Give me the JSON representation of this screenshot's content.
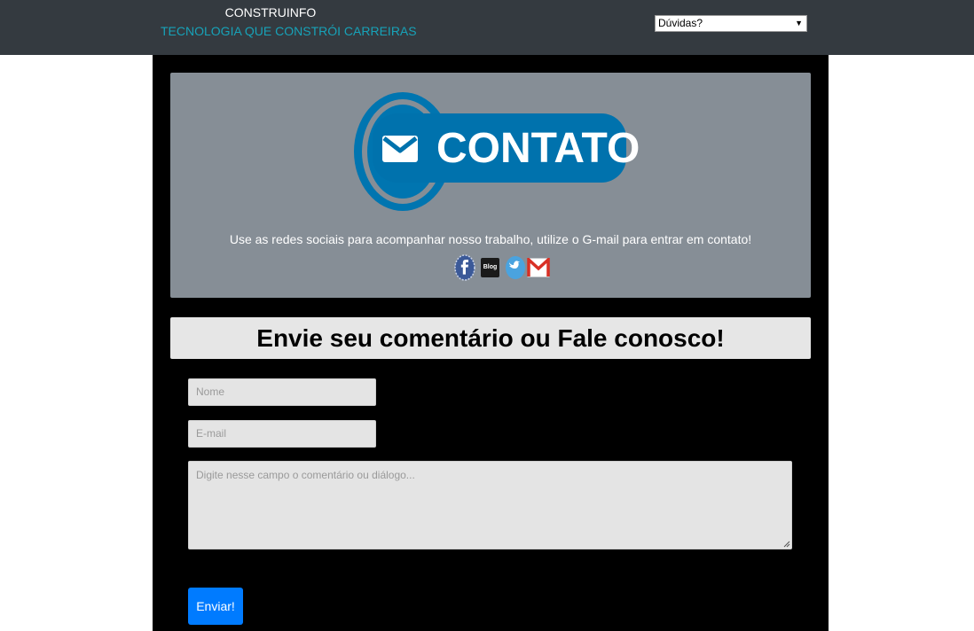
{
  "header": {
    "brand_title": "CONSTRUINFO",
    "brand_tagline": "TECNOLOGIA QUE CONSTRÓI CARREIRAS",
    "nav_select": {
      "selected": "Dúvidas?"
    }
  },
  "hero": {
    "logo_text": "CONTATO",
    "description": "Use as redes sociais para acompanhar nosso trabalho, utilize o G-mail para entrar em contato!",
    "social": [
      {
        "name": "facebook",
        "icon": "facebook-icon"
      },
      {
        "name": "blog",
        "icon": "blog-icon",
        "label": "Blog"
      },
      {
        "name": "twitter",
        "icon": "twitter-icon"
      },
      {
        "name": "gmail",
        "icon": "gmail-icon"
      }
    ]
  },
  "form": {
    "heading": "Envie seu comentário ou Fale conosco!",
    "name_placeholder": "Nome",
    "email_placeholder": "E-mail",
    "comment_placeholder": "Digite nesse campo o comentário ou diálogo...",
    "submit_label": "Enviar!"
  },
  "colors": {
    "topbar": "#343a40",
    "tagline": "#17a2b8",
    "hero_bg": "#868e96",
    "logo_blue": "#0072ad",
    "submit": "#007bff"
  }
}
